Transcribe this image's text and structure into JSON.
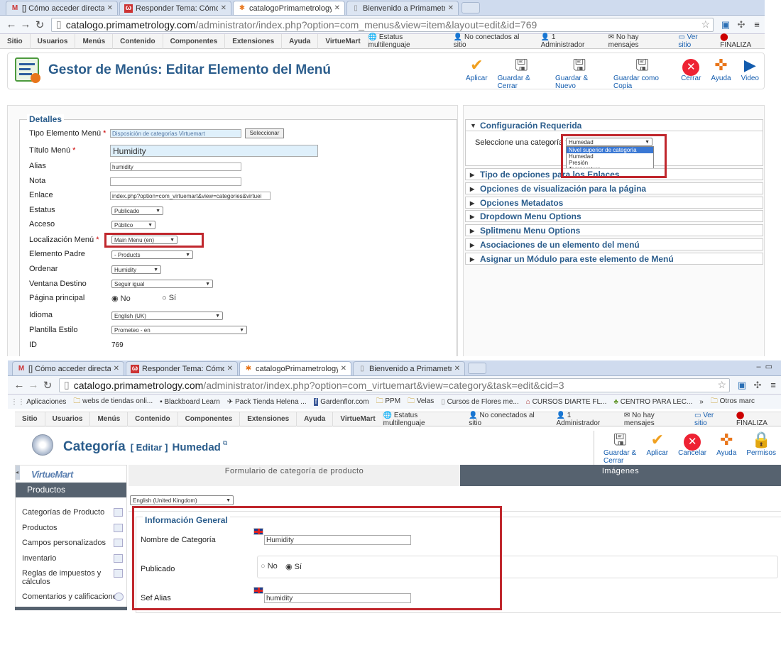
{
  "top": {
    "tabs": [
      {
        "label": "[] Cómo acceder directam",
        "icon": "gmail-icon"
      },
      {
        "label": "Responder Tema: Cómo a",
        "icon": "forum-icon"
      },
      {
        "label": "catalogoPrimametrology.",
        "icon": "joomla-icon"
      },
      {
        "label": "Bienvenido a Primametrol",
        "icon": "page-icon"
      }
    ],
    "url_host": "catalogo.primametrology.com",
    "url_path": "/administrator/index.php?option=com_menus&view=item&layout=edit&id=769",
    "menu": [
      "Sitio",
      "Usuarios",
      "Menús",
      "Contenido",
      "Componentes",
      "Extensiones",
      "Ayuda",
      "VirtueMart"
    ],
    "status": [
      "Estatus multilenguaje",
      "No conectados al sitio",
      "1 Administrador",
      "No hay mensajes",
      "Ver sitio",
      "FINALIZA"
    ],
    "page_title": "Gestor de Menús: Editar Elemento del Menú",
    "toolbar": [
      "Aplicar",
      "Guardar & Cerrar",
      "Guardar & Nuevo",
      "Guardar como Copia",
      "Cerrar",
      "Ayuda",
      "Video"
    ],
    "details_legend": "Detalles",
    "fields": {
      "tipo_label": "Tipo Elemento Menú",
      "tipo_value": "Disposición de categorías Virtuemart",
      "seleccionar": "Seleccionar",
      "titulo_label": "Título Menú",
      "titulo_value": "Humidity",
      "alias_label": "Alias",
      "alias_value": "humidity",
      "nota_label": "Nota",
      "nota_value": "",
      "enlace_label": "Enlace",
      "enlace_value": "index.php?option=com_virtuemart&view=categories&virtuei",
      "estatus_label": "Estatus",
      "estatus_value": "Publicado",
      "acceso_label": "Acceso",
      "acceso_value": "Público",
      "loc_label": "Localización Menú",
      "loc_value": "Main Menu (en)",
      "padre_label": "Elemento Padre",
      "padre_value": "- Products",
      "ordenar_label": "Ordenar",
      "ordenar_value": "Humidity",
      "ventana_label": "Ventana Destino",
      "ventana_value": "Seguir igual",
      "pagina_label": "Página principal",
      "pagina_no": "No",
      "pagina_si": "Sí",
      "idioma_label": "Idioma",
      "idioma_value": "English (UK)",
      "plantilla_label": "Plantilla Estilo",
      "plantilla_value": "Prometeo - en",
      "id_label": "ID",
      "id_value": "769"
    },
    "config": {
      "header": "Configuración Requerida",
      "label": "Seleccione una categoría",
      "selected": "Humedad",
      "options": [
        "Nivel superior de categoría",
        "Humedad",
        "Presión",
        "Temperatura"
      ],
      "overlap_text": "Tipo de opciones para los Enlaces"
    },
    "accordion": [
      "Opciones de visualización para la página",
      "Opciones Metadatos",
      "Dropdown Menu Options",
      "Splitmenu Menu Options",
      "Asociaciones de un elemento del menú",
      "Asignar un Módulo para este elemento de Menú"
    ]
  },
  "bottom": {
    "tabs": [
      {
        "label": "[] Cómo acceder directam",
        "icon": "gmail-icon"
      },
      {
        "label": "Responder Tema: Cómo a",
        "icon": "forum-icon"
      },
      {
        "label": "catalogoPrimametrology.",
        "icon": "joomla-icon"
      },
      {
        "label": "Bienvenido a Primametrol",
        "icon": "page-icon"
      }
    ],
    "url_host": "catalogo.primametrology.com",
    "url_path": "/administrator/index.php?option=com_virtuemart&view=category&task=edit&cid=3",
    "bookmarks": [
      "Aplicaciones",
      "webs de tiendas onli...",
      "Blackboard Learn",
      "Pack Tienda Helena ...",
      "Gardenflor.com",
      "PPM",
      "Velas",
      "Cursos de Flores me...",
      "CURSOS DIARTE FL...",
      "CENTRO PARA LEC...",
      "»",
      "Otros marc"
    ],
    "menu": [
      "Sitio",
      "Usuarios",
      "Menús",
      "Contenido",
      "Componentes",
      "Extensiones",
      "Ayuda",
      "VirtueMart"
    ],
    "status": [
      "Estatus multilenguaje",
      "No conectados al sitio",
      "1 Administrador",
      "No hay mensajes",
      "Ver sitio",
      "FINALIZA"
    ],
    "title_main": "Categoría",
    "title_edit": "[ Editar ]",
    "title_name": "Humedad",
    "toolbar": [
      "Guardar & Cerrar",
      "Aplicar",
      "Cancelar",
      "Ayuda",
      "Permisos"
    ],
    "vm_logo": "VirtueMart",
    "sidebar_header": "Productos",
    "sidebar": [
      "Categorías de Producto",
      "Productos",
      "Campos personalizados",
      "Inventario",
      "Reglas de impuestos y cálculos",
      "Comentarios y calificaciones"
    ],
    "form_tabs": [
      "Formulario de categoría de producto",
      "Imágenes"
    ],
    "language": "English (United Kingdom)",
    "legend": "Información General",
    "nombre_label": "Nombre de Categoría",
    "nombre_value": "Humidity",
    "publicado_label": "Publicado",
    "publicado_no": "No",
    "publicado_si": "Sí",
    "alias_label": "Sef Alias",
    "alias_value": "humidity"
  }
}
